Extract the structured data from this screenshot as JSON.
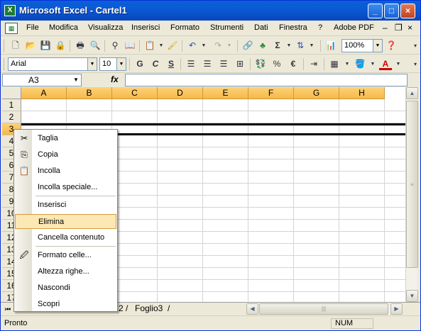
{
  "window": {
    "title": "Microsoft Excel - Cartel1",
    "app_icon": "X"
  },
  "window_controls": {
    "minimize": "_",
    "maximize": "□",
    "close": "×"
  },
  "menu": {
    "items": [
      "File",
      "Modifica",
      "Visualizza",
      "Inserisci",
      "Formato",
      "Strumenti",
      "Dati",
      "Finestra",
      "?",
      "Adobe PDF"
    ],
    "doc_controls": {
      "minimize": "–",
      "restore": "❐",
      "close": "×"
    }
  },
  "standard_toolbar": {
    "zoom": "100%"
  },
  "formatting_toolbar": {
    "font": "Arial",
    "size": "10",
    "bold": "G",
    "italic": "C",
    "underline": "S",
    "currency": "€",
    "percent": "%"
  },
  "formula_bar": {
    "cell_ref": "A3",
    "fx": "fx",
    "value": ""
  },
  "grid": {
    "columns": [
      "A",
      "B",
      "C",
      "D",
      "E",
      "F",
      "G",
      "H"
    ],
    "rows": [
      "1",
      "2",
      "3",
      "4",
      "5",
      "6",
      "7",
      "8",
      "9",
      "10",
      "11",
      "12",
      "13",
      "14",
      "15",
      "16",
      "17"
    ],
    "selected_row": "3"
  },
  "sheets": {
    "tab2_fragment": "2",
    "tab3": "Foglio3"
  },
  "context_menu": {
    "items": [
      {
        "label": "Taglia",
        "icon": "scissors-icon",
        "glyph": "✂"
      },
      {
        "label": "Copia",
        "icon": "copy-icon",
        "glyph": "⎘"
      },
      {
        "label": "Incolla",
        "icon": "paste-icon",
        "glyph": "📋"
      },
      {
        "label": "Incolla speciale...",
        "icon": "",
        "glyph": ""
      },
      {
        "label": "Inserisci",
        "icon": "",
        "glyph": ""
      },
      {
        "label": "Elimina",
        "icon": "",
        "glyph": "",
        "highlighted": true
      },
      {
        "label": "Cancella contenuto",
        "icon": "",
        "glyph": ""
      },
      {
        "label": "Formato celle...",
        "icon": "format-cells-icon",
        "glyph": "🖉"
      },
      {
        "label": "Altezza righe...",
        "icon": "",
        "glyph": ""
      },
      {
        "label": "Nascondi",
        "icon": "",
        "glyph": ""
      },
      {
        "label": "Scopri",
        "icon": "",
        "glyph": ""
      }
    ]
  },
  "status_bar": {
    "status": "Pronto",
    "num": "NUM"
  }
}
